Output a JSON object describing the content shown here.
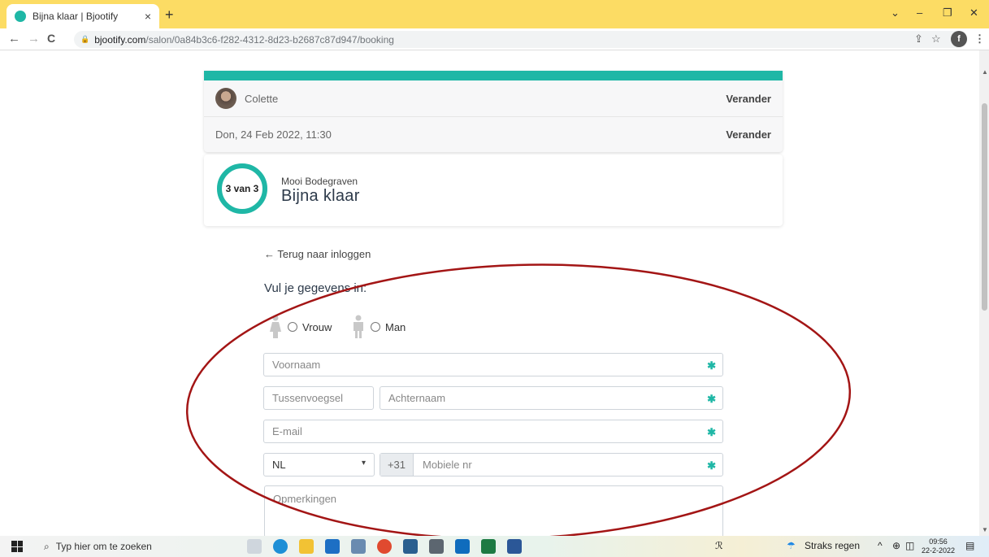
{
  "browser": {
    "tab_title": "Bijna klaar | Bjootify",
    "tab_close": "×",
    "new_tab": "+",
    "url_host": "bjootify.com",
    "url_path": "/salon/0a84b3c6-f282-4312-8d23-b2687c87d947/booking",
    "profile_initial": "f"
  },
  "booking": {
    "stylist": "Colette",
    "change_label": "Verander",
    "datetime": "Don, 24 Feb 2022, 11:30",
    "step_label": "3 van 3",
    "step_progress": 1.0,
    "salon_name": "Mooi Bodegraven",
    "step_title": "Bijna klaar"
  },
  "form": {
    "back_link": "← Terug naar inloggen",
    "title": "Vul je gegevens in:",
    "gender_female": "Vrouw",
    "gender_male": "Man",
    "first_name_placeholder": "Voornaam",
    "infix_placeholder": "Tussenvoegsel",
    "last_name_placeholder": "Achternaam",
    "email_placeholder": "E-mail",
    "country_value": "NL",
    "phone_prefix": "+31",
    "phone_placeholder": "Mobiele nr",
    "remarks_placeholder": "Opmerkingen",
    "required_marker": "✱"
  },
  "taskbar": {
    "search_placeholder": "Typ hier om te zoeken",
    "weather": "Straks regen",
    "time": "09:56",
    "date": "22-2-2022"
  },
  "colors": {
    "accent": "#1fb7a6",
    "tabstrip": "#fcdc64",
    "annotation": "#a31515"
  }
}
